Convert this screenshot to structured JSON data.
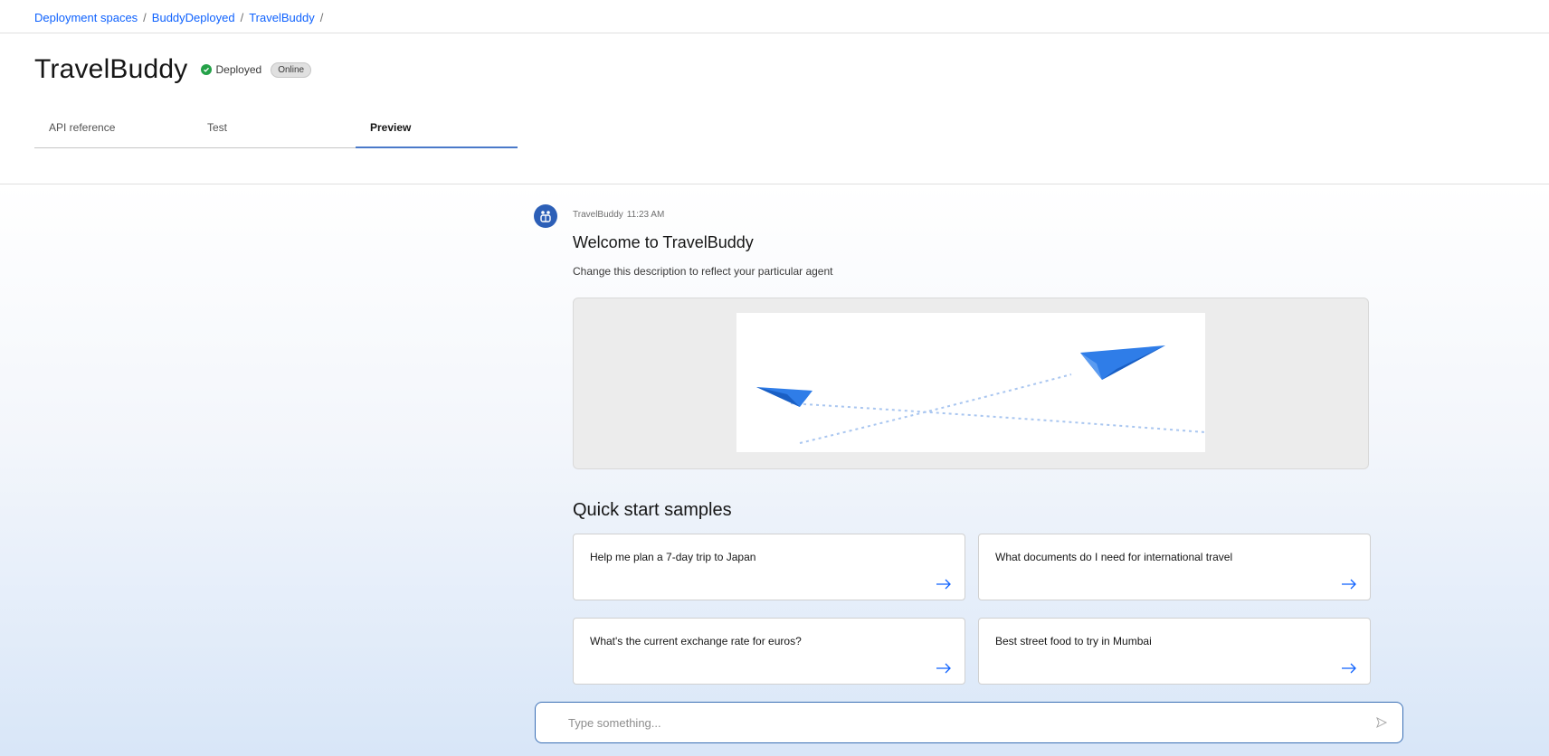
{
  "breadcrumb": {
    "items": [
      "Deployment spaces",
      "BuddyDeployed",
      "TravelBuddy"
    ],
    "separator": "/"
  },
  "header": {
    "title": "TravelBuddy",
    "status": "Deployed",
    "badge": "Online"
  },
  "tabs": [
    {
      "label": "API reference",
      "active": false
    },
    {
      "label": "Test",
      "active": false
    },
    {
      "label": "Preview",
      "active": true
    }
  ],
  "chat": {
    "sender": "TravelBuddy",
    "time": "11:23 AM",
    "welcome_title": "Welcome to TravelBuddy",
    "welcome_description": "Change this description to reflect your particular agent",
    "avatar_icon": "agent-avatar-icon",
    "hero_icon": "paper-plane-icon"
  },
  "quick_start": {
    "title": "Quick start samples",
    "items": [
      {
        "label": "Help me plan a 7-day trip to Japan"
      },
      {
        "label": "What documents do I need for international travel"
      },
      {
        "label": "What's the current exchange rate for euros?"
      },
      {
        "label": "Best street food to try in Mumbai"
      }
    ]
  },
  "input": {
    "placeholder": "Type something...",
    "value": ""
  },
  "colors": {
    "accent": "#0f62fe",
    "status_green": "#24a148",
    "input_border": "#3a6fb5",
    "plane_blue": "#2f7de8"
  }
}
